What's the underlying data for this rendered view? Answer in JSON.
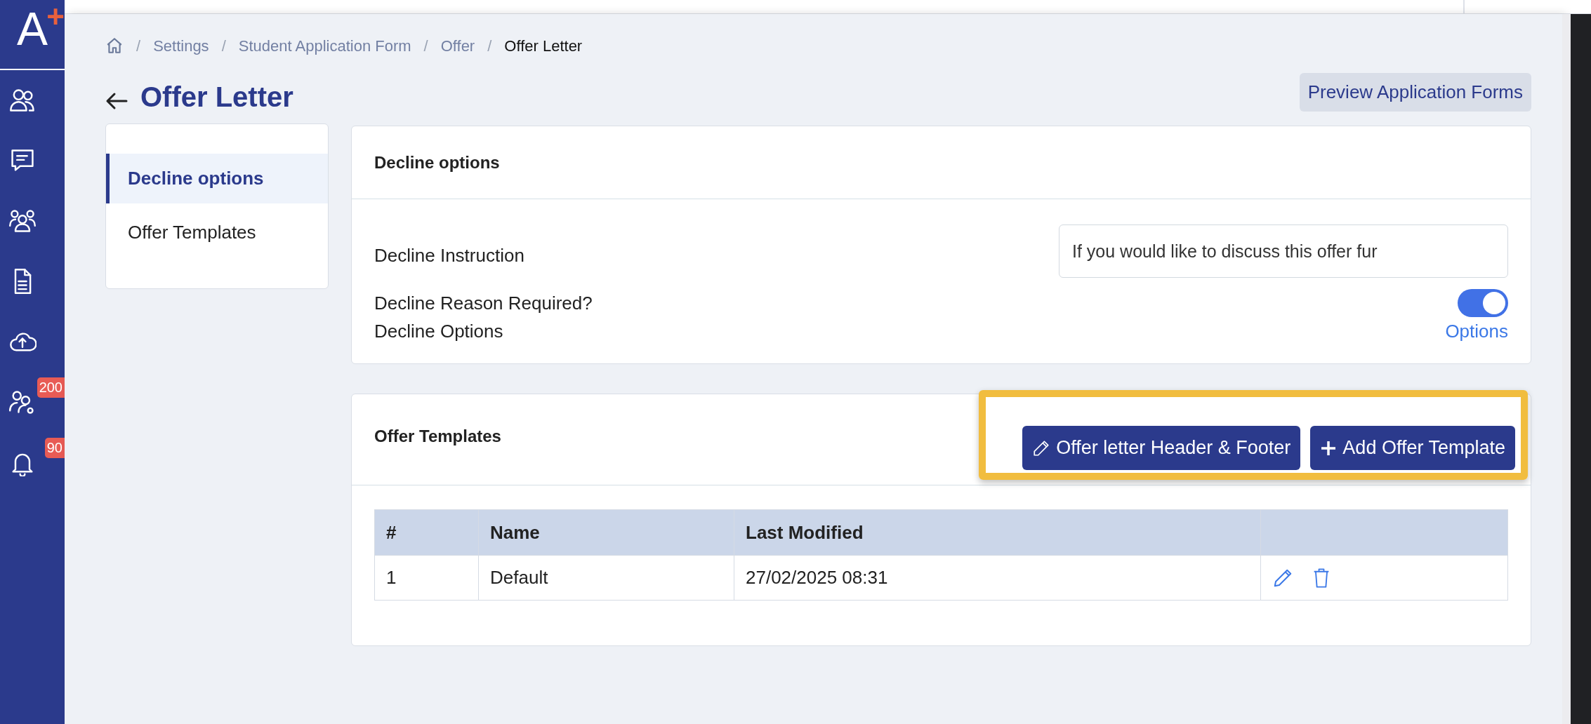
{
  "sidebar": {
    "logo": {
      "letter": "A",
      "mark": "+"
    },
    "items": [
      {
        "kind": "users"
      },
      {
        "kind": "chat"
      },
      {
        "kind": "group"
      },
      {
        "kind": "document"
      },
      {
        "kind": "upload"
      },
      {
        "kind": "user-settings",
        "badge": "200"
      },
      {
        "kind": "bell",
        "badge": "90"
      }
    ]
  },
  "breadcrumb": [
    {
      "separator": "/",
      "label": "Settings",
      "current": false
    },
    {
      "separator": "/",
      "label": "Student Application Form",
      "current": false
    },
    {
      "separator": "/",
      "label": "Offer",
      "current": false
    },
    {
      "separator": "/",
      "label": "Offer Letter",
      "current": true
    }
  ],
  "page_title": "Offer Letter",
  "preview_button": "Preview Application Forms",
  "nav": [
    {
      "label": "Decline options",
      "selected": true
    },
    {
      "label": "Offer Templates",
      "selected": false
    }
  ],
  "decline_card": {
    "title": "Decline options",
    "rows": [
      {
        "kind": "text",
        "label": "Decline Instruction",
        "value": "If you would like to discuss this offer fur"
      },
      {
        "kind": "toggle",
        "label": "Decline Reason Required?",
        "on": true
      },
      {
        "kind": "link",
        "label": "Decline Options",
        "link": "Options"
      }
    ]
  },
  "templates_card": {
    "title": "Offer Templates",
    "highlighted": true,
    "buttons": [
      {
        "kind": "pencil",
        "label": "Offer letter Header & Footer"
      },
      {
        "kind": "plus",
        "label": "Add Offer Template"
      }
    ],
    "table": {
      "columns": [
        "#",
        "Name",
        "Last Modified"
      ],
      "rows": [
        {
          "cells": [
            "1",
            "Default",
            "27/02/2025 08:31"
          ],
          "actions": [
            {
              "kind": "edit"
            },
            {
              "kind": "delete"
            }
          ]
        }
      ]
    }
  }
}
